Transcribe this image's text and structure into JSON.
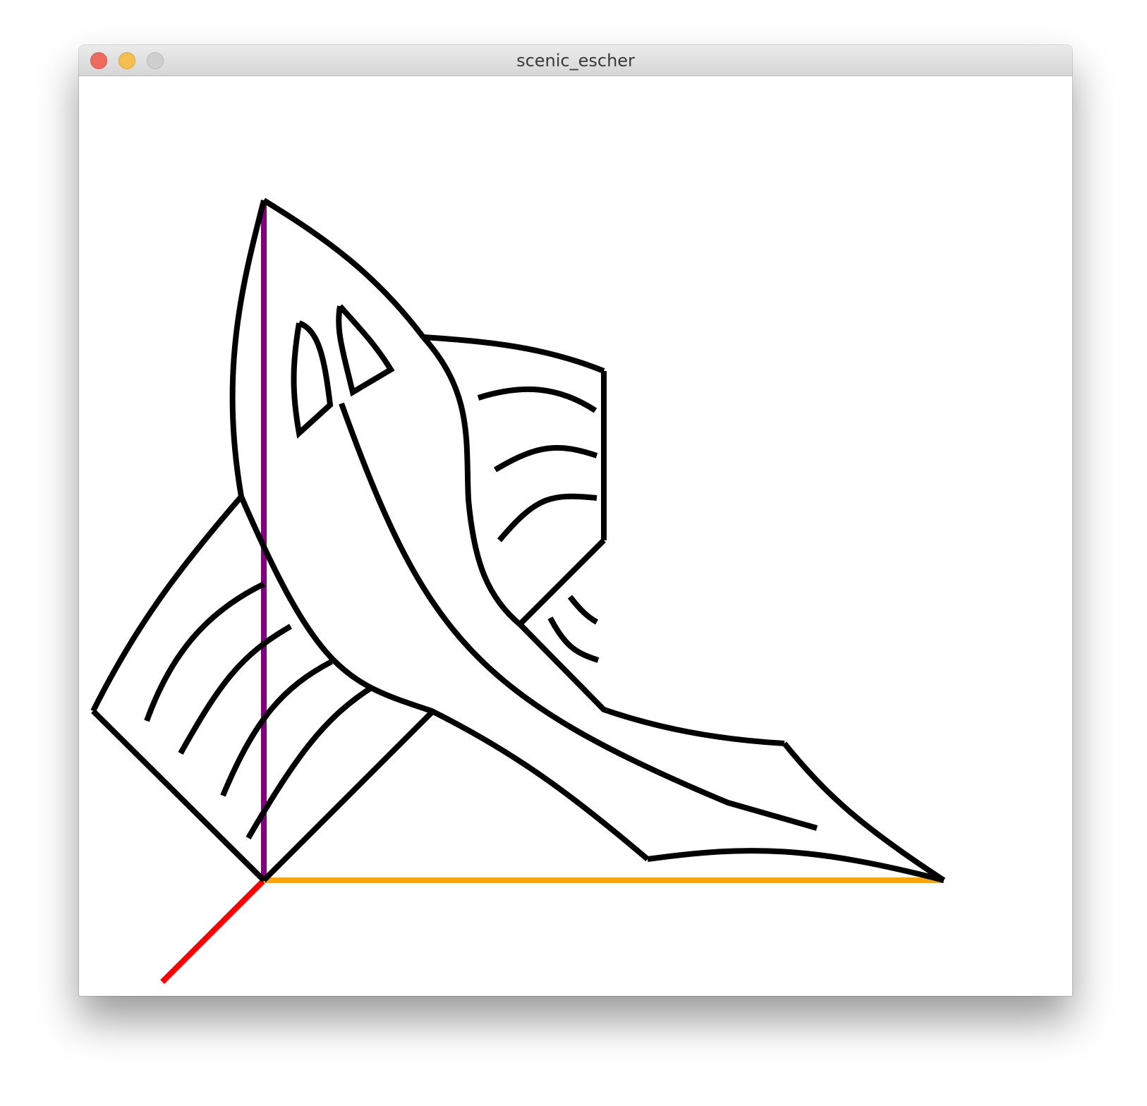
{
  "window": {
    "title": "scenic_escher",
    "controls": {
      "close": {
        "icon": "close-dot-icon",
        "color": "#ee6a5f"
      },
      "minimize": {
        "icon": "minimize-dot-icon",
        "color": "#f5bf4f"
      },
      "zoom": {
        "icon": "zoom-dot-icon",
        "color": "#cfcfcf"
      }
    }
  },
  "drawing": {
    "stroke_color": "#000000",
    "background": "#ffffff",
    "frame_vectors": {
      "origin": {
        "color": "#ff0000"
      },
      "edge": {
        "color": "#ffa500"
      },
      "up": {
        "color": "#800080"
      }
    }
  }
}
